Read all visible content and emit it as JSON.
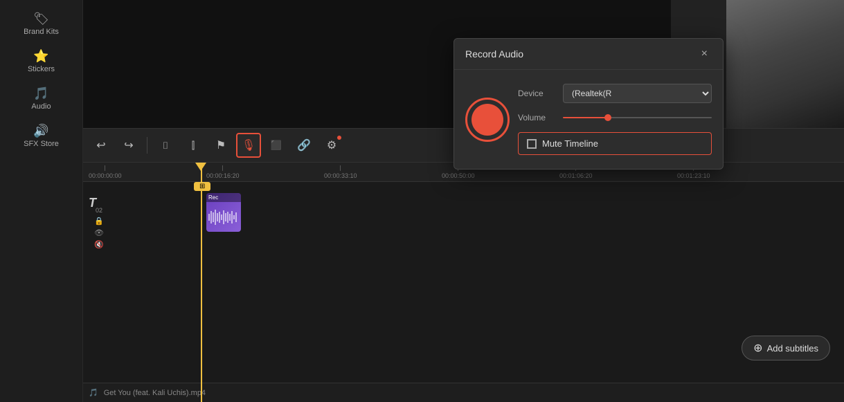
{
  "sidebar": {
    "items": [
      {
        "id": "brand-kits",
        "icon": "🏷",
        "label": "Brand Kits"
      },
      {
        "id": "stickers",
        "icon": "⭐",
        "label": "Stickers"
      },
      {
        "id": "audio",
        "icon": "🎵",
        "label": "Audio"
      },
      {
        "id": "sfx-store",
        "icon": "🔊",
        "label": "SFX Store"
      }
    ]
  },
  "toolbar": {
    "buttons": [
      {
        "id": "undo",
        "icon": "↩",
        "label": "Undo",
        "active": false
      },
      {
        "id": "redo",
        "icon": "↪",
        "label": "Redo",
        "active": false
      },
      {
        "id": "trim",
        "icon": "⌷",
        "label": "Trim",
        "active": false
      },
      {
        "id": "split",
        "icon": "⫿",
        "label": "Split",
        "active": false
      },
      {
        "id": "flag",
        "icon": "⚑",
        "label": "Flag",
        "active": false
      },
      {
        "id": "record-audio",
        "icon": "🎙",
        "label": "Record Audio",
        "active": true
      },
      {
        "id": "caption",
        "icon": "⬛",
        "label": "Caption",
        "active": false
      },
      {
        "id": "link",
        "icon": "🔗",
        "label": "Link",
        "active": false
      },
      {
        "id": "more",
        "icon": "⋮",
        "label": "More",
        "active": false
      }
    ]
  },
  "timeline": {
    "current_time": "00:00:16:20",
    "ruler_marks": [
      {
        "time": "00:00:00:00",
        "pos": 0
      },
      {
        "time": "00:00:16:20",
        "pos": 170
      },
      {
        "time": "00:00:33:10",
        "pos": 340
      },
      {
        "time": "00:00:50:00",
        "pos": 510
      },
      {
        "time": "00:01:06:20",
        "pos": 680
      },
      {
        "time": "00:01:23:10",
        "pos": 850
      }
    ],
    "track_number": "02",
    "audio_track_label": "Get You (feat. Kali Uchis).mp4"
  },
  "dialog": {
    "title": "Record Audio",
    "close_label": "×",
    "device_label": "Device",
    "device_value": "(Realtek(R",
    "volume_label": "Volume",
    "mute_label": "Mute Timeline",
    "mute_checked": false
  },
  "subtitles": {
    "button_label": "Add subtitles"
  },
  "playback": {
    "pause_label": "⏸",
    "play_label": "▶",
    "stop_label": "⏹"
  }
}
